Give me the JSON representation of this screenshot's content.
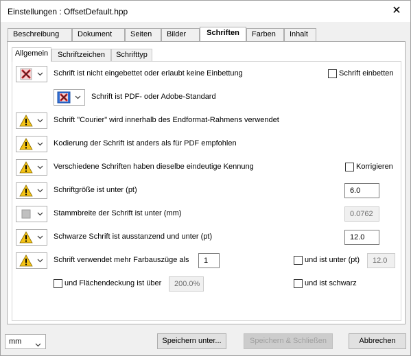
{
  "window": {
    "title": "Einstellungen :  OffsetDefault.hpp",
    "close_glyph": "✕"
  },
  "outer_tabs": [
    {
      "label": "Beschreibung"
    },
    {
      "label": "Dokument"
    },
    {
      "label": "Seiten"
    },
    {
      "label": "Bilder"
    },
    {
      "label": "Schriften",
      "active": true
    },
    {
      "label": "Farben"
    },
    {
      "label": "Inhalt"
    }
  ],
  "inner_tabs": [
    {
      "label": "Allgemein",
      "active": true
    },
    {
      "label": "Schriftzeichen"
    },
    {
      "label": "Schrifttyp"
    }
  ],
  "rules": {
    "not_embedded": {
      "icon": "error-x-icon",
      "label": "Schrift ist nicht eingebettet oder erlaubt keine Einbettung",
      "checkbox_label": "Schrift einbetten",
      "checked": false
    },
    "pdf_standard": {
      "icon": "error-x-icon",
      "label": "Schrift ist PDF- oder Adobe-Standard"
    },
    "courier": {
      "icon": "warning-icon",
      "label": "Schrift \"Courier\" wird innerhalb des Endformat-Rahmens verwendet"
    },
    "encoding": {
      "icon": "warning-icon",
      "label": "Kodierung der Schrift ist anders als für PDF empfohlen"
    },
    "same_id": {
      "icon": "warning-icon",
      "label": "Verschiedene Schriften haben dieselbe eindeutige Kennung",
      "checkbox_label": "Korrigieren",
      "checked": false
    },
    "size_below": {
      "icon": "warning-icon",
      "label": "Schriftgröße ist unter (pt)",
      "value": "6.0"
    },
    "stem_below": {
      "icon": "inactive-square-icon",
      "label": "Stammbreite der Schrift ist unter (mm)",
      "value": "0.0762"
    },
    "black_knockout": {
      "icon": "warning-icon",
      "label": "Schwarze Schrift ist ausstanzend und unter (pt)",
      "value": "12.0"
    },
    "separations": {
      "icon": "warning-icon",
      "label": "Schrift verwendet mehr Farbauszüge als",
      "value": "1",
      "and_below_label": "und ist unter (pt)",
      "and_below_value": "12.0",
      "and_below_checked": false
    },
    "coverage": {
      "label": "und Flächendeckung ist über",
      "value": "200.0%",
      "checked": false,
      "and_black_label": "und ist schwarz",
      "and_black_checked": false
    }
  },
  "footer": {
    "unit": "mm",
    "save_as_label": "Speichern unter...",
    "save_close_label": "Speichern & Schließen",
    "cancel_label": "Abbrechen"
  },
  "colors": {
    "error_red": "#d9252a",
    "error_blue_bg": "#2f6fd6",
    "warning_yellow": "#f4c316",
    "inactive_gray": "#c0c0c0"
  }
}
